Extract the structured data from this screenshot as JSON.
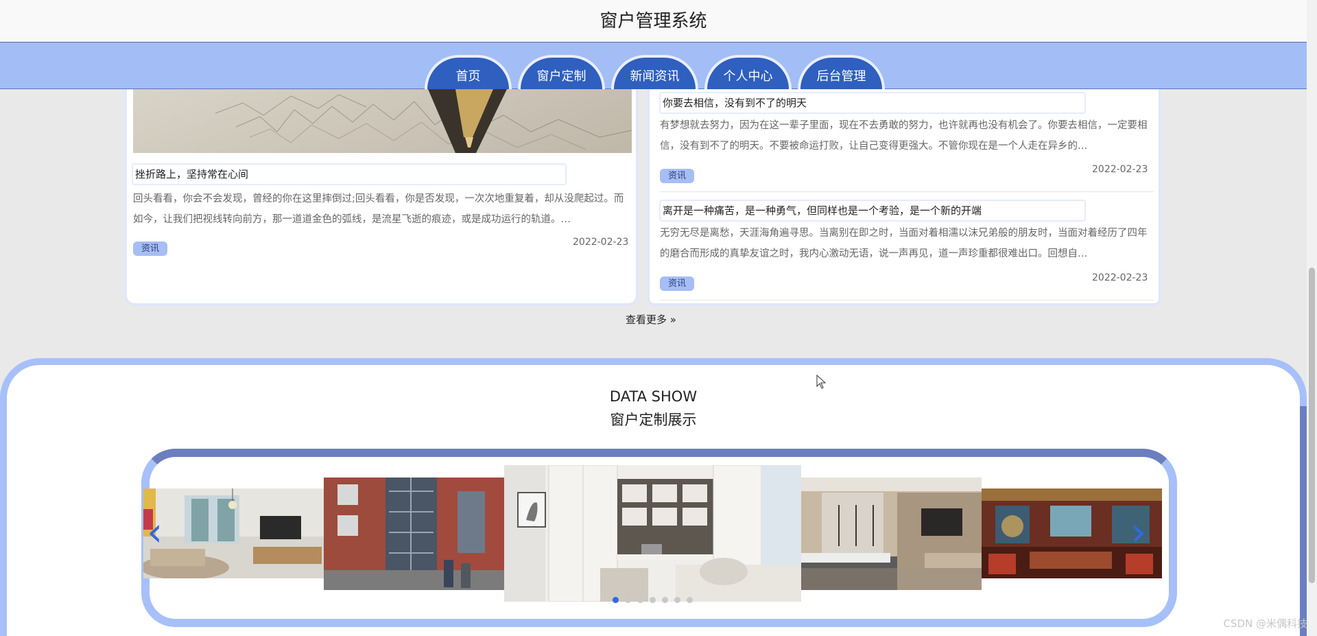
{
  "app_title": "窗户管理系统",
  "nav": [
    "首页",
    "窗户定制",
    "新闻资讯",
    "个人中心",
    "后台管理"
  ],
  "news": {
    "left": {
      "title": "挫折路上，坚持常在心间",
      "desc": "回头看看，你会不会发现，曾经的你在这里摔倒过;回头看看，你是否发现，一次次地重复着，却从没爬起过。而如今，让我们把视线转向前方，那一道道金色的弧线，是流星飞逝的痕迹，或是成功运行的轨道。…",
      "tag": "资讯",
      "date": "2022-02-23"
    },
    "right": [
      {
        "title": "你要去相信，没有到不了的明天",
        "desc": "有梦想就去努力，因为在这一辈子里面，现在不去勇敢的努力，也许就再也没有机会了。你要去相信，一定要相信，没有到不了的明天。不要被命运打败，让自己变得更强大。不管你现在是一个人走在异乡的…",
        "tag": "资讯",
        "date": "2022-02-23"
      },
      {
        "title": "离开是一种痛苦，是一种勇气，但同样也是一个考验，是一个新的开端",
        "desc": "无穷无尽是离愁，天涯海角遍寻思。当离别在即之时，当面对着相濡以沫兄弟般的朋友时，当面对着经历了四年的磨合而形成的真挚友谊之时，我内心激动无语，说一声再见，道一声珍重都很难出口。回想自…",
        "tag": "资讯",
        "date": "2022-02-23"
      }
    ],
    "more_label": "查看更多",
    "more_icon": "double-chevron-right-icon"
  },
  "showcase": {
    "title_en": "DATA SHOW",
    "title_cn": "窗户定制展示",
    "prev_icon": "chevron-left-icon",
    "next_icon": "chevron-right-icon",
    "slide_count": 7,
    "active_slide": 1
  },
  "watermark": "CSDN @米偶科技",
  "colors": {
    "accent": "#2f5fbf",
    "nav_band": "#a3bdf6",
    "frame": "#a7c0fa",
    "frame_dark": "#6b7ebe",
    "tag": "#a7bdf5"
  }
}
